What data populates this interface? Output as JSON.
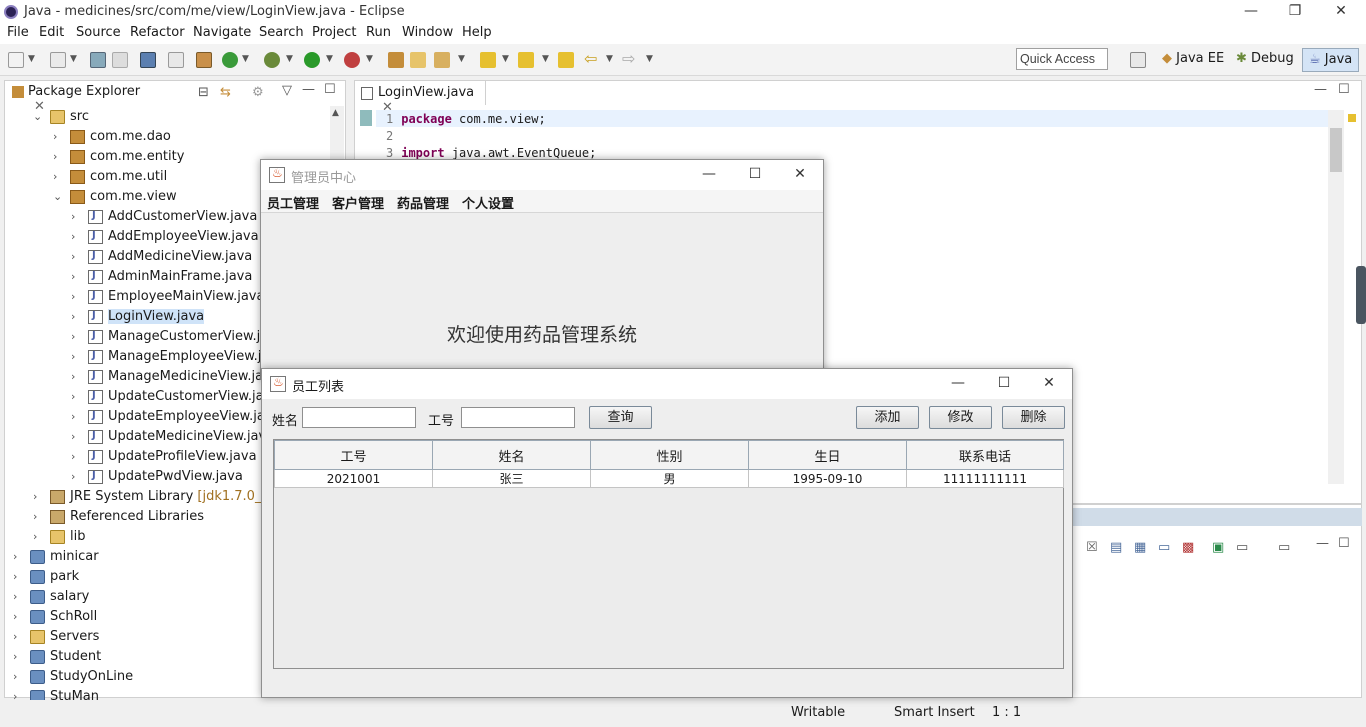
{
  "eclipse": {
    "title": "Java - medicines/src/com/me/view/LoginView.java - Eclipse",
    "menu": [
      "File",
      "Edit",
      "Source",
      "Refactor",
      "Navigate",
      "Search",
      "Project",
      "Run",
      "Window",
      "Help"
    ],
    "quick_access": "Quick Access",
    "perspectives": [
      "Java EE",
      "Debug",
      "Java"
    ],
    "package_explorer": {
      "title": "Package Explorer",
      "tree": [
        {
          "label": "src",
          "kind": "folder",
          "state": "open"
        },
        {
          "label": "com.me.dao",
          "kind": "pkg",
          "state": "closed"
        },
        {
          "label": "com.me.entity",
          "kind": "pkg",
          "state": "closed"
        },
        {
          "label": "com.me.util",
          "kind": "pkg",
          "state": "closed"
        },
        {
          "label": "com.me.view",
          "kind": "pkg",
          "state": "open"
        },
        {
          "label": "AddCustomerView.java",
          "kind": "java"
        },
        {
          "label": "AddEmployeeView.java",
          "kind": "java"
        },
        {
          "label": "AddMedicineView.java",
          "kind": "java"
        },
        {
          "label": "AdminMainFrame.java",
          "kind": "java"
        },
        {
          "label": "EmployeeMainView.java",
          "kind": "java"
        },
        {
          "label": "LoginView.java",
          "kind": "java",
          "selected": true
        },
        {
          "label": "ManageCustomerView.java",
          "kind": "java"
        },
        {
          "label": "ManageEmployeeView.java",
          "kind": "java"
        },
        {
          "label": "ManageMedicineView.java",
          "kind": "java"
        },
        {
          "label": "UpdateCustomerView.java",
          "kind": "java"
        },
        {
          "label": "UpdateEmployeeView.java",
          "kind": "java"
        },
        {
          "label": "UpdateMedicineView.java",
          "kind": "java"
        },
        {
          "label": "UpdateProfileView.java",
          "kind": "java"
        },
        {
          "label": "UpdatePwdView.java",
          "kind": "java"
        },
        {
          "label": "JRE System Library",
          "suffix": "[jdk1.7.0_80]",
          "kind": "lib"
        },
        {
          "label": "Referenced Libraries",
          "kind": "lib"
        },
        {
          "label": "lib",
          "kind": "folder"
        },
        {
          "label": "minicar",
          "kind": "proj"
        },
        {
          "label": "park",
          "kind": "proj"
        },
        {
          "label": "salary",
          "kind": "proj"
        },
        {
          "label": "SchRoll",
          "kind": "proj"
        },
        {
          "label": "Servers",
          "kind": "folder"
        },
        {
          "label": "Student",
          "kind": "proj"
        },
        {
          "label": "StudyOnLine",
          "kind": "proj"
        },
        {
          "label": "StuMan",
          "kind": "proj"
        }
      ]
    },
    "editor": {
      "tab": "LoginView.java",
      "lines": [
        {
          "num": "1",
          "kw": "package",
          "rest": " com.me.view;"
        },
        {
          "num": "2",
          "kw": "",
          "rest": ""
        },
        {
          "num": "3",
          "kw": "import",
          "rest": " java.awt.EventQueue;"
        }
      ]
    },
    "status": {
      "writable": "Writable",
      "insert": "Smart Insert",
      "pos": "1 : 1"
    }
  },
  "admin_frame": {
    "title": "管理员中心",
    "menus": [
      "员工管理",
      "客户管理",
      "药品管理",
      "个人设置"
    ],
    "welcome": "欢迎使用药品管理系统"
  },
  "employee_frame": {
    "title": "员工列表",
    "name_label": "姓名",
    "id_label": "工号",
    "name_value": "",
    "id_value": "",
    "query_button": "查询",
    "add_button": "添加",
    "edit_button": "修改",
    "delete_button": "删除",
    "columns": [
      "工号",
      "姓名",
      "性别",
      "生日",
      "联系电话"
    ],
    "rows": [
      [
        "2021001",
        "张三",
        "男",
        "1995-09-10",
        "11111111111"
      ]
    ]
  }
}
